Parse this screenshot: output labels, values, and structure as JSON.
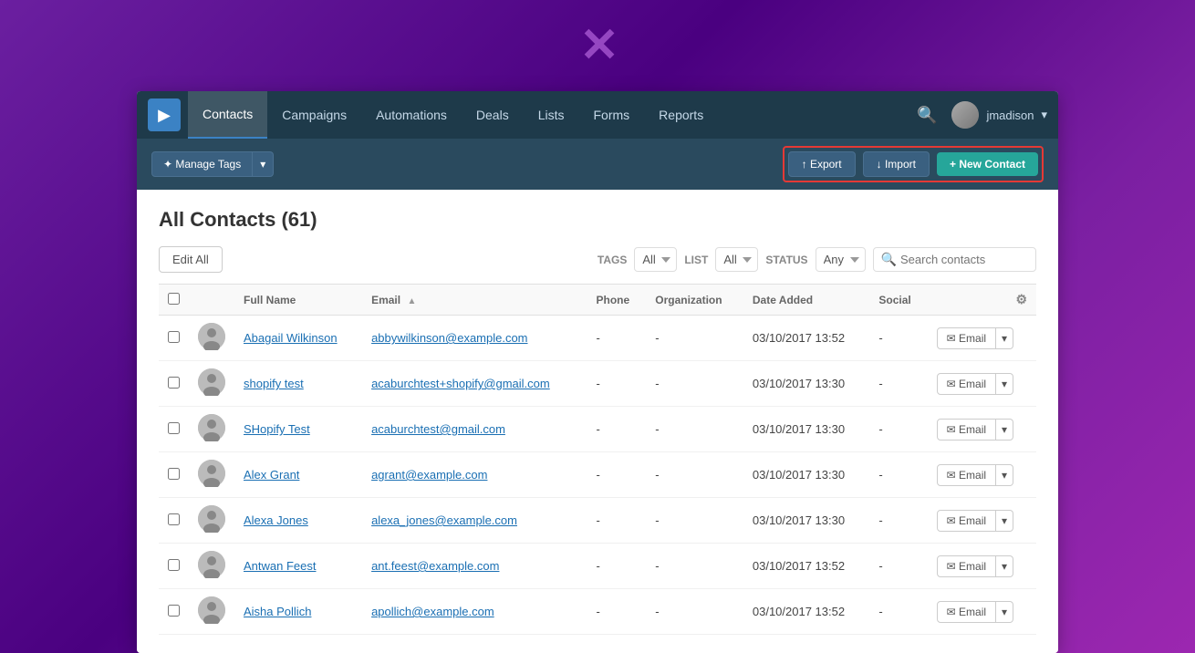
{
  "logo": "✕",
  "navbar": {
    "logo_icon": "▶",
    "items": [
      {
        "label": "Contacts",
        "active": true
      },
      {
        "label": "Campaigns",
        "active": false
      },
      {
        "label": "Automations",
        "active": false
      },
      {
        "label": "Deals",
        "active": false
      },
      {
        "label": "Lists",
        "active": false
      },
      {
        "label": "Forms",
        "active": false
      },
      {
        "label": "Reports",
        "active": false
      }
    ],
    "user_name": "jmadison",
    "user_chevron": "▾"
  },
  "toolbar": {
    "manage_tags_label": "✦ Manage Tags",
    "dropdown_arrow": "▾",
    "export_label": "↑ Export",
    "import_label": "↓ Import",
    "new_contact_label": "+ New Contact"
  },
  "content": {
    "page_title": "All Contacts (61)",
    "edit_all_label": "Edit All",
    "tags_label": "TAGS",
    "list_label": "LIST",
    "status_label": "STATUS",
    "tags_value": "All",
    "list_value": "All",
    "status_value": "Any",
    "search_placeholder": "Search contacts",
    "columns": [
      "Full Name",
      "Email ▲",
      "Phone",
      "Organization",
      "Date Added",
      "Social",
      ""
    ],
    "contacts": [
      {
        "name": "Abagail Wilkinson",
        "email": "abbywilkinson@example.com",
        "phone": "-",
        "org": "-",
        "date": "03/10/2017 13:52",
        "social": "-"
      },
      {
        "name": "shopify test",
        "email": "acaburchtest+shopify@gmail.com",
        "phone": "-",
        "org": "-",
        "date": "03/10/2017 13:30",
        "social": "-"
      },
      {
        "name": "SHopify Test",
        "email": "acaburchtest@gmail.com",
        "phone": "-",
        "org": "-",
        "date": "03/10/2017 13:30",
        "social": "-"
      },
      {
        "name": "Alex Grant",
        "email": "agrant@example.com",
        "phone": "-",
        "org": "-",
        "date": "03/10/2017 13:30",
        "social": "-"
      },
      {
        "name": "Alexa Jones",
        "email": "alexa_jones@example.com",
        "phone": "-",
        "org": "-",
        "date": "03/10/2017 13:30",
        "social": "-"
      },
      {
        "name": "Antwan Feest",
        "email": "ant.feest@example.com",
        "phone": "-",
        "org": "-",
        "date": "03/10/2017 13:52",
        "social": "-"
      },
      {
        "name": "Aisha Pollich",
        "email": "apollich@example.com",
        "phone": "-",
        "org": "-",
        "date": "03/10/2017 13:52",
        "social": "-"
      }
    ],
    "email_btn_label": "✉ Email"
  }
}
